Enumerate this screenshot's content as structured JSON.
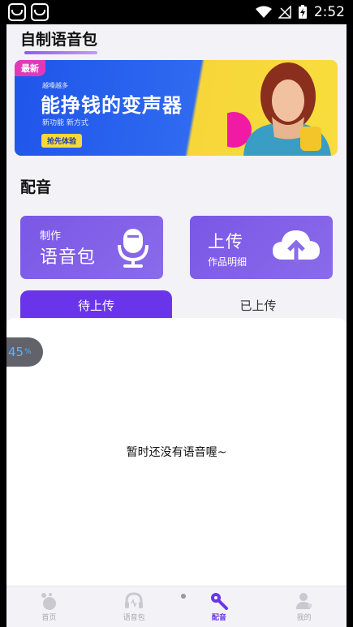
{
  "status_bar": {
    "time": "2:52"
  },
  "page": {
    "section1_title": "自制语音包",
    "section2_title": "配音"
  },
  "banner": {
    "badge": "最新",
    "small_text": "越嗓越多",
    "headline": "能挣钱的变声器",
    "sub": "新功能 新方式",
    "button": "抢先体验"
  },
  "cards": {
    "make": {
      "line1": "制作",
      "line2": "语音包",
      "icon": "microphone-icon"
    },
    "upload": {
      "line1": "上传",
      "line2": "作品明细",
      "icon": "cloud-upload-icon"
    }
  },
  "tabs": [
    {
      "label": "待上传",
      "active": true
    },
    {
      "label": "已上传",
      "active": false
    }
  ],
  "empty_message": "暂时还没有语音喔~",
  "floating_badge": {
    "value": "45",
    "unit": "%"
  },
  "nav": [
    {
      "label": "首页",
      "icon": "home-icon",
      "active": false
    },
    {
      "label": "语音包",
      "icon": "headphones-icon",
      "active": false
    },
    {
      "label": "配音",
      "icon": "dubbing-icon",
      "active": true
    },
    {
      "label": "我的",
      "icon": "profile-icon",
      "active": false
    }
  ],
  "colors": {
    "accent": "#6a35ea",
    "card": "#7b57e6",
    "background": "#f3f2f7"
  }
}
